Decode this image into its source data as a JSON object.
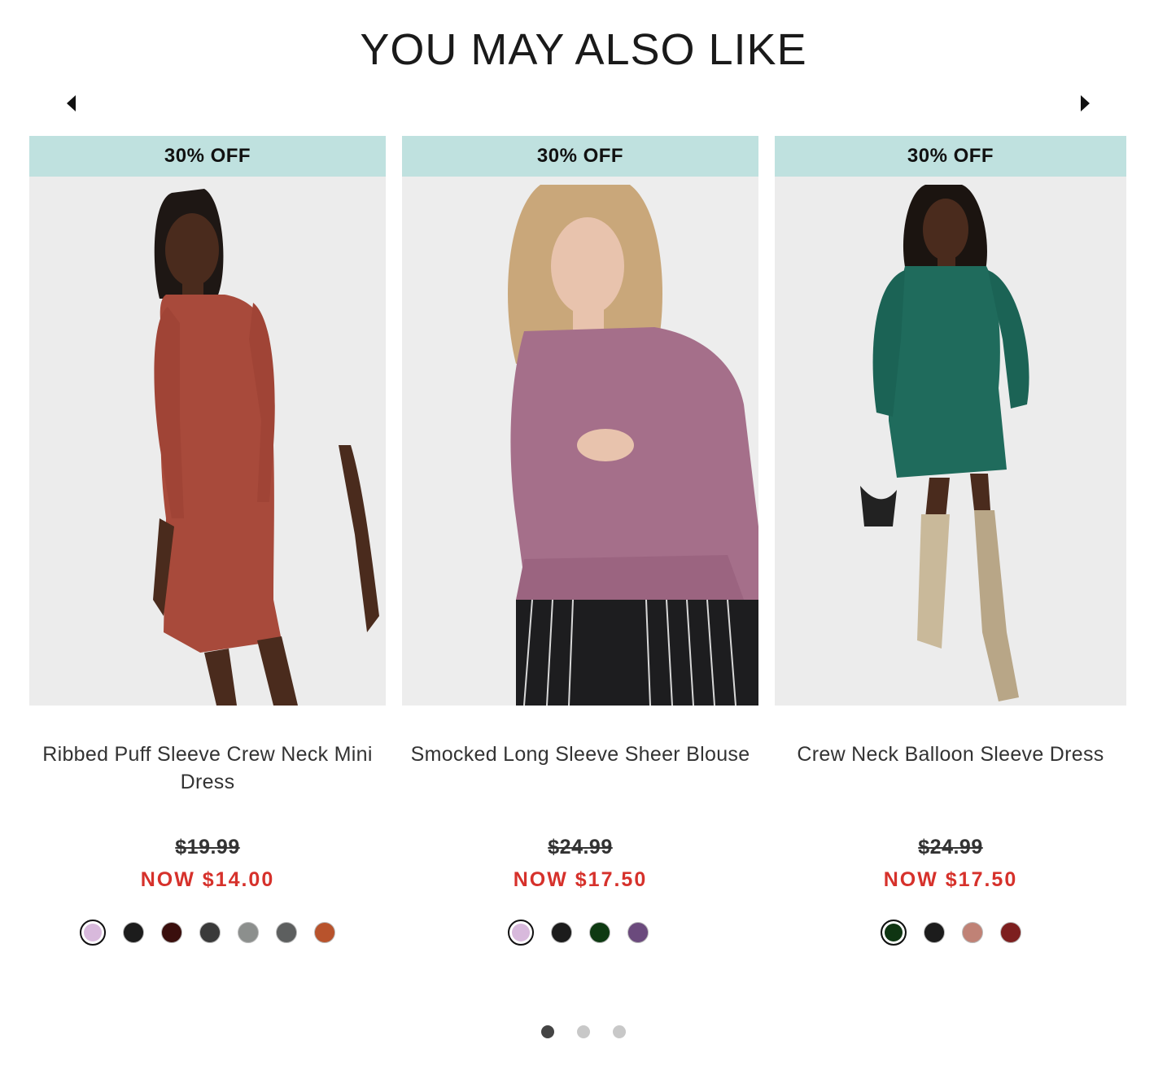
{
  "section": {
    "title": "YOU MAY ALSO LIKE"
  },
  "carousel": {
    "prev_icon": "caret-left-icon",
    "next_icon": "caret-right-icon",
    "page_count": 3,
    "active_page": 1
  },
  "products": [
    {
      "badge": "30% OFF",
      "name": "Ribbed Puff Sleeve Crew Neck Mini Dress",
      "original_price": "$19.99",
      "sale_price": "NOW $14.00",
      "swatches": [
        "#d8b9dc",
        "#1c1c1c",
        "#3a0f0d",
        "#3a3a3a",
        "#8c8f8d",
        "#5d5f5f",
        "#b8532c"
      ],
      "selected_swatch": 0
    },
    {
      "badge": "30% OFF",
      "name": "Smocked Long Sleeve Sheer Blouse",
      "original_price": "$24.99",
      "sale_price": "NOW $17.50",
      "swatches": [
        "#d8b9dc",
        "#1c1c1c",
        "#0e3a12",
        "#6b4a7d"
      ],
      "selected_swatch": 0
    },
    {
      "badge": "30% OFF",
      "name": "Crew Neck Balloon Sleeve Dress",
      "original_price": "$24.99",
      "sale_price": "NOW $17.50",
      "swatches": [
        "#0f3512",
        "#1c1c1c",
        "#c08276",
        "#7d1f1f"
      ],
      "selected_swatch": 0
    }
  ],
  "colors": {
    "badge_bg": "#bfe1df",
    "sale_price": "#d6312b"
  }
}
